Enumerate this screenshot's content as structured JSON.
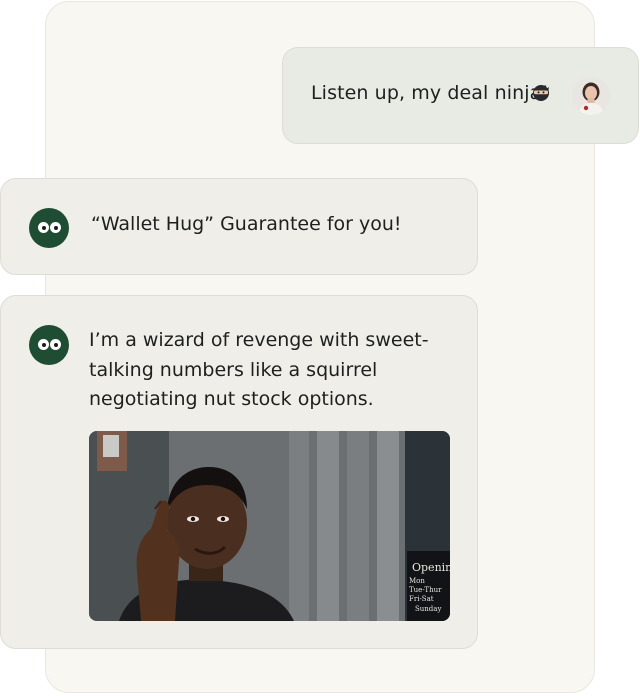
{
  "chat": {
    "messages": [
      {
        "role": "user",
        "text": "Listen up, my deal ninja!",
        "emoji_icon": "ninja-emoji-icon",
        "avatar_icon": "user-avatar-photo"
      },
      {
        "role": "assistant",
        "text": "“Wallet Hug” Guarantee for you!",
        "avatar_icon": "eyes-bot-avatar"
      },
      {
        "role": "assistant",
        "text": "I’m a wizard of revenge with sweet-talking numbers like a squirrel negotiating nut stock options.",
        "avatar_icon": "eyes-bot-avatar",
        "image": {
          "type": "meme-photo",
          "storefront_sign": "Opening\nMon\nTue-Thur\nFri-Sat\nSunday"
        }
      }
    ]
  },
  "colors": {
    "bot_avatar": "#1f4d33",
    "bubble": "#efeee9",
    "user_bubble": "#e8eae4",
    "backdrop": "#f8f7f2",
    "text": "#1f201d"
  }
}
